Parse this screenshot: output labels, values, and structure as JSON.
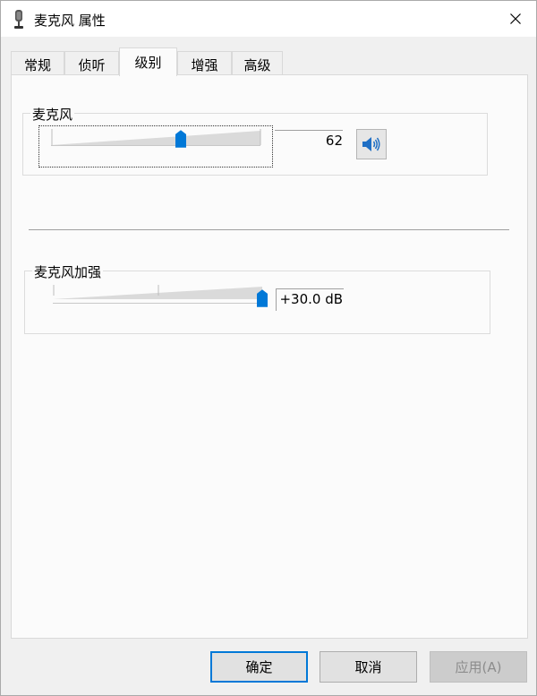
{
  "window": {
    "title": "麦克风 属性",
    "close_symbol": "✕"
  },
  "tabs": [
    {
      "label": "常规",
      "active": false
    },
    {
      "label": "侦听",
      "active": false
    },
    {
      "label": "级别",
      "active": true
    },
    {
      "label": "增强",
      "active": false
    },
    {
      "label": "高级",
      "active": false
    }
  ],
  "microphone": {
    "group_label": "麦克风",
    "level_value": "62",
    "level_fraction": 0.62,
    "mute_icon": "speaker-icon"
  },
  "boost": {
    "group_label": "麦克风加强",
    "value": "+30.0 dB",
    "level_fraction": 1.0
  },
  "buttons": {
    "ok": "确定",
    "cancel": "取消",
    "apply": "应用(A)"
  },
  "colors": {
    "accent": "#0078d7",
    "thumb": "#0078d7"
  }
}
